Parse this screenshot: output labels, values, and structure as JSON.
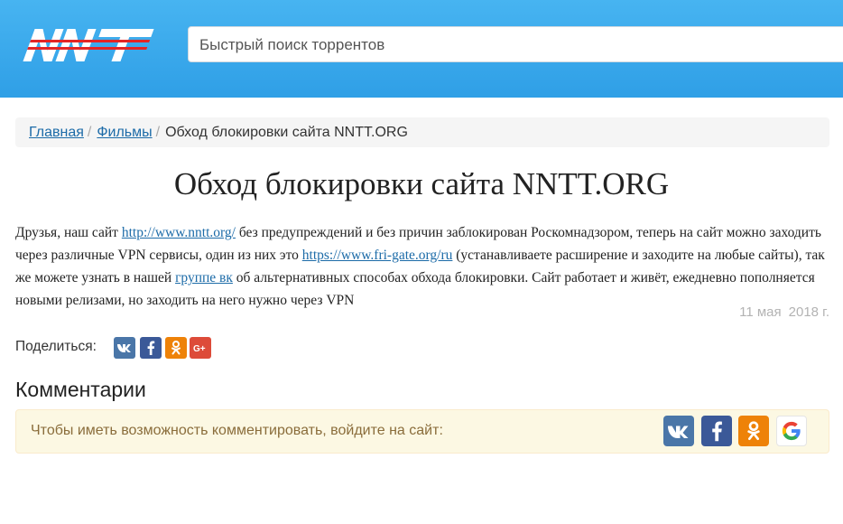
{
  "header": {
    "logo_text": "NNT",
    "search_placeholder": "Быстрый поиск торрентов"
  },
  "breadcrumb": {
    "home": "Главная",
    "section": "Фильмы",
    "separator": "/",
    "current": "Обход блокировки сайта NNTT.ORG"
  },
  "article": {
    "title": "Обход блокировки сайта NNTT.ORG",
    "text_1": "Друзья, наш сайт ",
    "link_1": "http://www.nntt.org/",
    "text_2": " без предупреждений и без причин заблокирован Роскомнадзором, теперь на сайт можно заходить через различные VPN сервисы, один из них это ",
    "link_2": "https://www.fri-gate.org/ru",
    "text_3": " (устанавливаете расширение и заходите на любые сайты), так же можете узнать в нашей ",
    "link_3": "группе вк",
    "text_4": " об альтернативных способах обхода блокировки. Сайт работает и живёт, ежедневно пополняется новыми релизами, но заходить на него нужно через VPN",
    "date_day": "11 мая",
    "date_year": "2018 г."
  },
  "share": {
    "label": "Поделиться:",
    "buttons": [
      "vk",
      "facebook",
      "odnoklassniki",
      "google-plus"
    ]
  },
  "comments": {
    "title": "Комментарии",
    "login_prompt": "Чтобы иметь возможность комментировать, войдите на сайт:"
  },
  "colors": {
    "header": "#3aa9ec",
    "vk": "#4a76a8",
    "facebook": "#3b5998",
    "odnoklassniki": "#ee8208",
    "google_plus": "#dd4b39",
    "link": "#1c6ba8"
  }
}
